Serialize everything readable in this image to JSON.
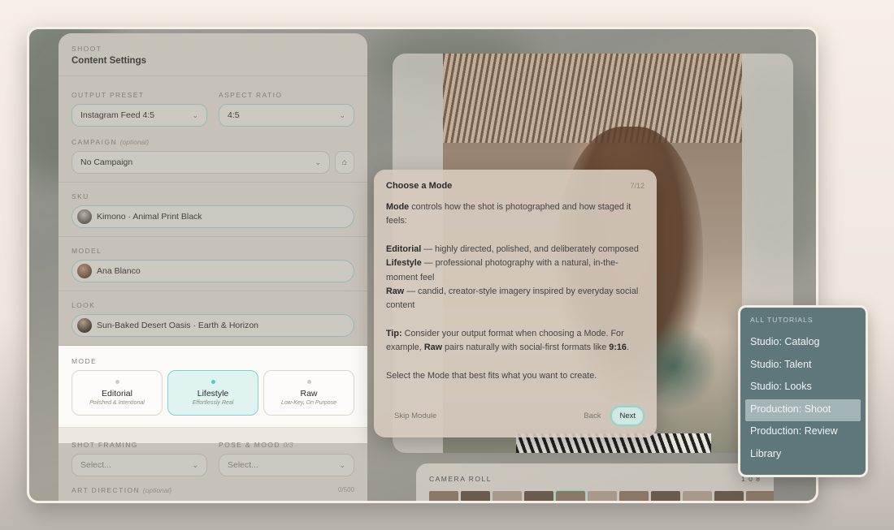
{
  "settings": {
    "eyebrow": "SHOOT",
    "title": "Content Settings",
    "output_preset": {
      "label": "OUTPUT PRESET",
      "value": "Instagram Feed 4:5"
    },
    "aspect_ratio": {
      "label": "ASPECT RATIO",
      "value": "4:5"
    },
    "campaign": {
      "label": "CAMPAIGN",
      "optional": "(optional)",
      "value": "No Campaign"
    },
    "sku": {
      "label": "SKU",
      "value": "Kimono · Animal Print Black"
    },
    "model": {
      "label": "MODEL",
      "value": "Ana Blanco"
    },
    "look": {
      "label": "LOOK",
      "value": "Sun-Baked Desert Oasis · Earth & Horizon"
    },
    "mode": {
      "label": "MODE",
      "options": [
        {
          "name": "Editorial",
          "sub": "Polished & Intentional"
        },
        {
          "name": "Lifestyle",
          "sub": "Effortlessly Real"
        },
        {
          "name": "Raw",
          "sub": "Low-Key, On Purpose"
        }
      ],
      "selected": "Lifestyle"
    },
    "shot_framing": {
      "label": "SHOT FRAMING",
      "placeholder": "Select..."
    },
    "pose_mood": {
      "label": "POSE & MOOD",
      "count": "0/3",
      "placeholder": "Select..."
    },
    "art_direction": {
      "label": "ART DIRECTION",
      "optional": "(optional)",
      "count": "0/500"
    }
  },
  "camera_roll": {
    "label": "CAMERA ROLL",
    "count": "1 0 8"
  },
  "tutorial": {
    "title": "Choose a Mode",
    "step": "7/12",
    "intro_bold": "Mode",
    "intro_rest": " controls how the shot is photographed and how staged it feels:",
    "editorial_bold": "Editorial",
    "editorial_rest": " — highly directed, polished, and deliberately composed",
    "lifestyle_bold": "Lifestyle",
    "lifestyle_rest": " — professional photography with a natural, in-the-moment feel",
    "raw_bold": "Raw",
    "raw_rest": " — candid, creator-style imagery inspired by everyday social content",
    "tip_bold": "Tip:",
    "tip_rest1": " Consider your output format when choosing a Mode. For example, ",
    "tip_raw": "Raw",
    "tip_rest2": " pairs naturally with social-first formats like ",
    "tip_ratio": "9:16",
    "tip_end": ".",
    "closing": "Select the Mode that best fits what you want to create.",
    "skip_label": "Skip Module",
    "back_label": "Back",
    "next_label": "Next"
  },
  "tutorials_menu": {
    "header": "ALL TUTORIALS",
    "items": [
      "Studio: Catalog",
      "Studio: Talent",
      "Studio: Looks",
      "Production: Shoot",
      "Production: Review",
      "Library"
    ],
    "active": "Production: Shoot"
  },
  "colors": {
    "accent": "#7fd3cc",
    "menu_bg": "#5f767b"
  }
}
